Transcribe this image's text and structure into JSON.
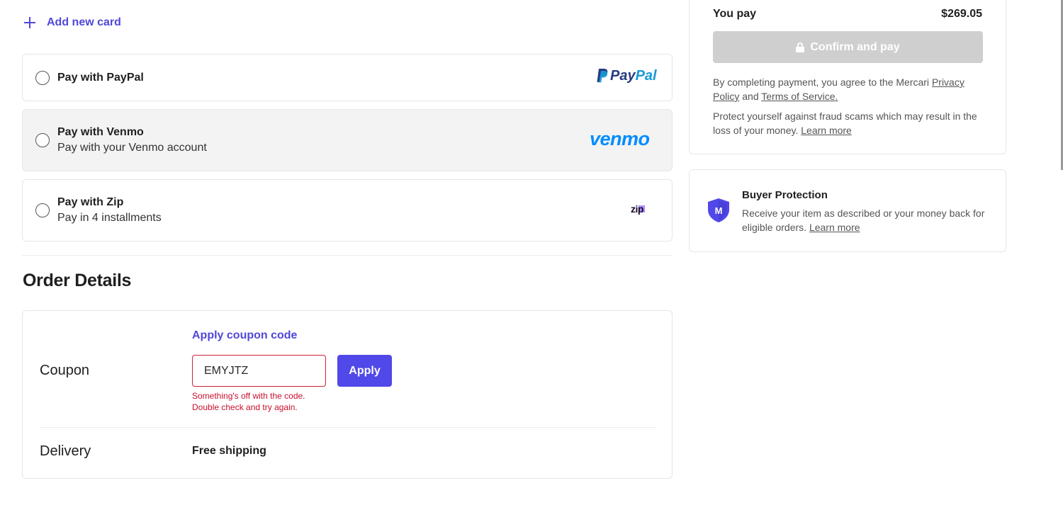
{
  "payment": {
    "add_card_label": "Add new card",
    "options": [
      {
        "title": "Pay with PayPal",
        "subtitle": "",
        "logo": "PayPal"
      },
      {
        "title": "Pay with Venmo",
        "subtitle": "Pay with your Venmo account",
        "logo": "venmo"
      },
      {
        "title": "Pay with Zip",
        "subtitle": "Pay in 4 installments",
        "logo": "zip"
      }
    ]
  },
  "order": {
    "title": "Order Details",
    "coupon_label": "Coupon",
    "apply_coupon_link": "Apply coupon code",
    "coupon_value": "EMYJTZ",
    "apply_label": "Apply",
    "error_line1": "Something's off with the code.",
    "error_line2": "Double check and try again.",
    "delivery_label": "Delivery",
    "delivery_value": "Free shipping"
  },
  "summary": {
    "you_pay_label": "You pay",
    "total": "$269.05",
    "confirm_label": "Confirm and pay",
    "legal_prefix": "By completing payment, you agree to the Mercari ",
    "privacy_link": "Privacy Policy",
    "legal_and": " and ",
    "terms_link": "Terms of Service.",
    "fraud_text": "Protect yourself against fraud scams which may result in the loss of your money. ",
    "learn_more": "Learn more"
  },
  "protection": {
    "title": "Buyer Protection",
    "text": "Receive your item as described or your money back for eligible orders. ",
    "learn_more": "Learn more"
  },
  "colors": {
    "accent": "#5048e8",
    "error": "#c8102e",
    "disabled_button": "#cfcfcf",
    "paypal_dark": "#253b80",
    "paypal_light": "#179bd7",
    "venmo": "#008cff"
  }
}
